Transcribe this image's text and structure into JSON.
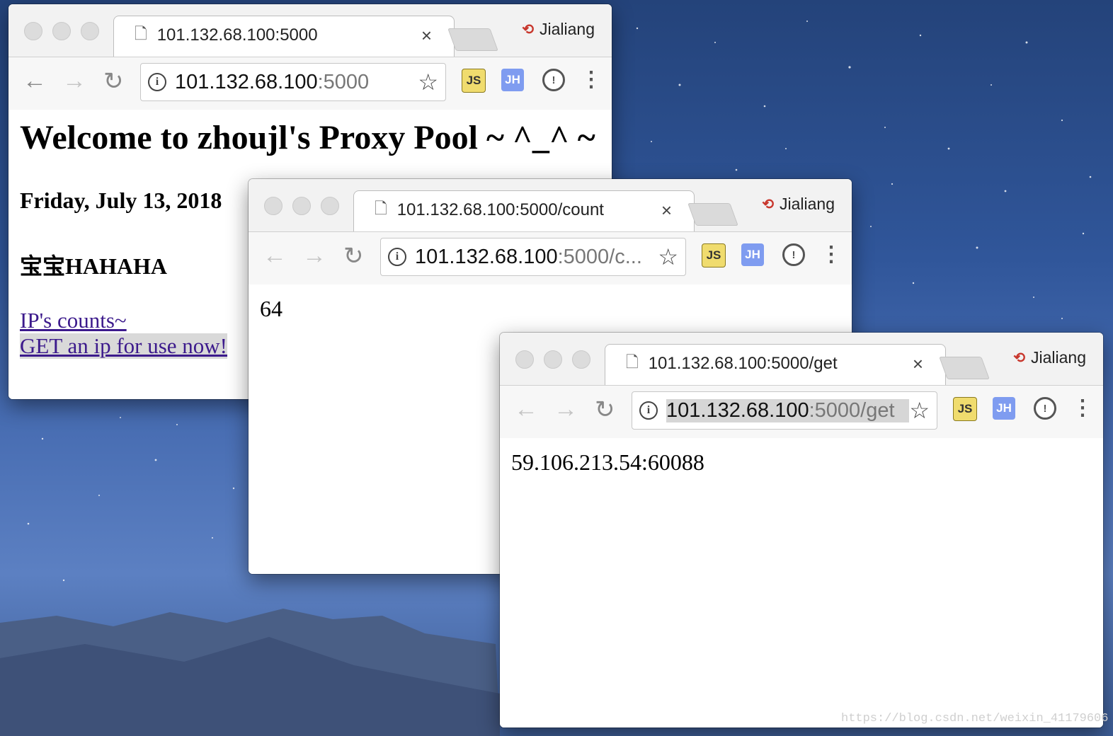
{
  "background": {
    "colors": {
      "sky": "#30569a",
      "mountains": "#3d5d96"
    }
  },
  "windows": [
    {
      "tab_title": "101.132.68.100:5000",
      "profile_name": "Jialiang",
      "url_host": "101.132.68.100",
      "url_path": ":5000",
      "page": {
        "heading": "Welcome to zhoujl's Proxy Pool ~ ^_^ ~",
        "date": "Friday, July 13, 2018",
        "line": "宝宝HAHAHA",
        "link1": "IP's counts~",
        "link2": "GET an ip for use now!"
      }
    },
    {
      "tab_title": "101.132.68.100:5000/count",
      "profile_name": "Jialiang",
      "url_host": "101.132.68.100",
      "url_path": ":5000/c...",
      "page": {
        "value": "64"
      }
    },
    {
      "tab_title": "101.132.68.100:5000/get",
      "profile_name": "Jialiang",
      "url_host": "101.132.68.100",
      "url_path": ":5000/get",
      "page": {
        "value": "59.106.213.54:60088"
      }
    }
  ],
  "icons": {
    "back": "←",
    "forward": "→",
    "reload": "↻",
    "star": "☆",
    "close": "×",
    "info": "i",
    "menu": "⋮",
    "ext_js": "JS",
    "ext_jh": "JH",
    "ext_pw": "!",
    "profile_icon": "⟲"
  },
  "watermark": "https://blog.csdn.net/weixin_41179606",
  "colors": {
    "link": "#3c1a8c",
    "profile": "#c8372d",
    "ext_js": "#f0dc6e",
    "ext_jh": "#7f9cf0"
  }
}
